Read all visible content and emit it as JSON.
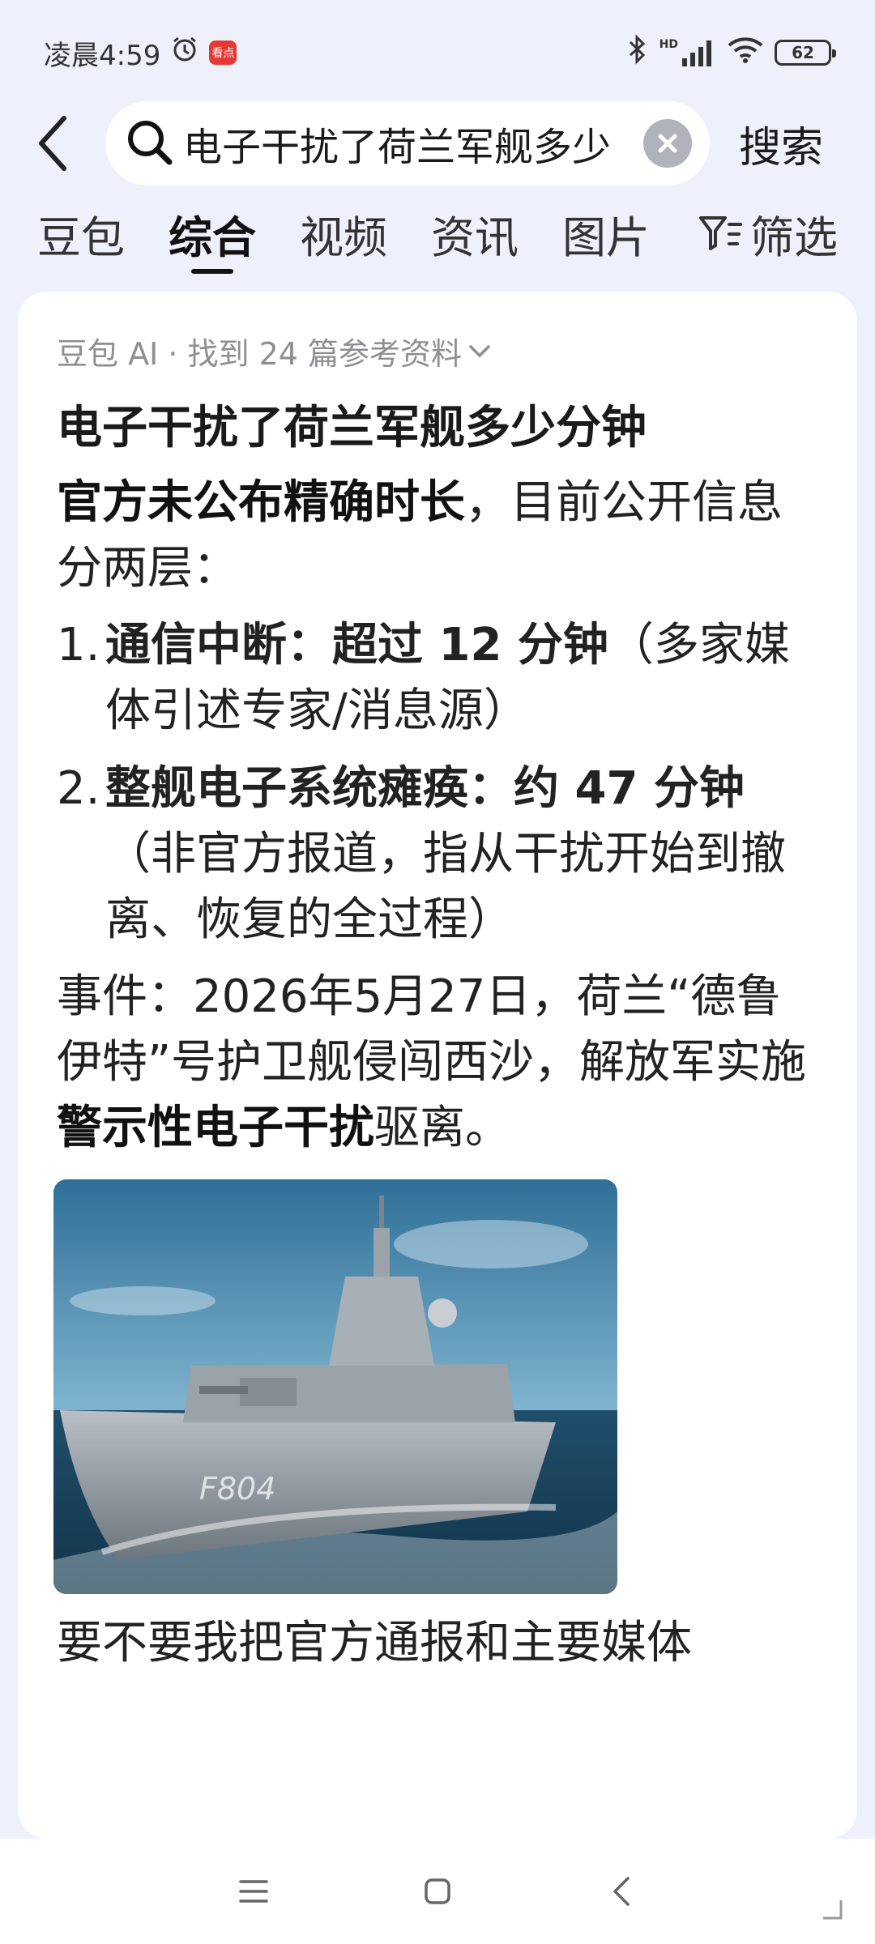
{
  "status_bar": {
    "time": "凌晨4:59",
    "app_badge": "看点",
    "signal_label": "HD",
    "battery": "62"
  },
  "search": {
    "query": "电子干扰了荷兰军舰多少分钟",
    "submit_label": "搜索"
  },
  "tabs": [
    {
      "label": "豆包",
      "active": false
    },
    {
      "label": "综合",
      "active": true
    },
    {
      "label": "视频",
      "active": false
    },
    {
      "label": "资讯",
      "active": false
    },
    {
      "label": "图片",
      "active": false
    }
  ],
  "filter_label": "筛选",
  "card": {
    "source_label": "豆包 AI · 找到 24 篇参考资料",
    "question": "电子干扰了荷兰军舰多少分钟",
    "intro_bold": "官方未公布精确时长",
    "intro_rest": "，目前公开信息分两层：",
    "items": [
      {
        "num": "1.",
        "bold": "通信中断：超过 12 分钟",
        "rest": "（多家媒体引述专家/消息源）"
      },
      {
        "num": "2.",
        "bold": "整舰电子系统瘫痪：约 47 分钟",
        "rest": "（非官方报道，指从干扰开始到撤离、恢复的全过程）"
      }
    ],
    "event_prefix": "事件：2026年5月27日，荷兰“德鲁伊特”号护卫舰侵闯西沙，解放军实施",
    "event_bold": "警示性电子干扰",
    "event_suffix": "驱离。",
    "ship_hull_number": "F804",
    "trailing": "要不要我把官方通报和主要媒体"
  },
  "colors": {
    "background": "#eef1fb",
    "card": "#ffffff",
    "muted": "#8e8e93"
  }
}
